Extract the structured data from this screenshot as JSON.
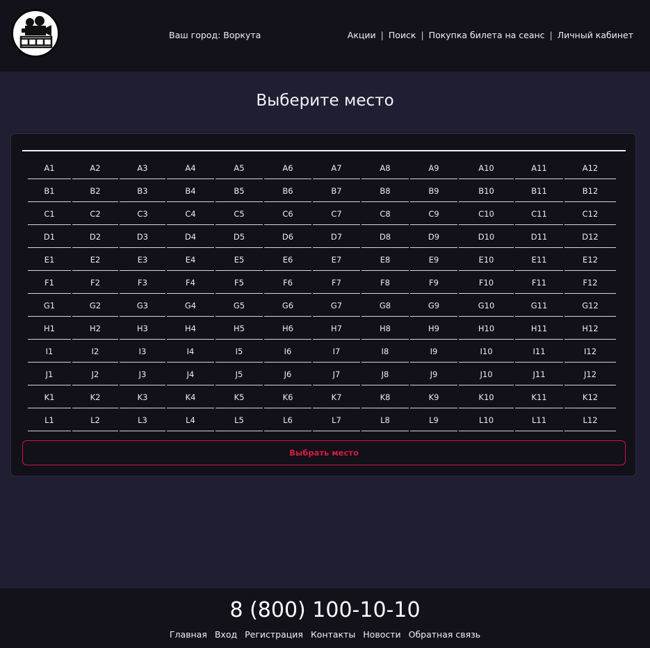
{
  "header": {
    "logo_icon": "film-camera-icon",
    "city_label": "Ваш город: Воркута",
    "nav": [
      {
        "label": "Акции"
      },
      {
        "label": "Поиск"
      },
      {
        "label": "Покупка билета на сеанс"
      },
      {
        "label": "Личный кабинет"
      }
    ],
    "nav_separator": "|"
  },
  "main": {
    "title": "Выберите место",
    "rows": [
      "A",
      "B",
      "C",
      "D",
      "E",
      "F",
      "G",
      "H",
      "I",
      "J",
      "K",
      "L"
    ],
    "seats_per_row": 12,
    "choose_button": "Выбрать место"
  },
  "footer": {
    "phone": "8 (800) 100-10-10",
    "links": [
      {
        "label": "Главная"
      },
      {
        "label": "Вход"
      },
      {
        "label": "Регистрация"
      },
      {
        "label": "Контакты"
      },
      {
        "label": "Новости"
      },
      {
        "label": "Обратная связь"
      }
    ]
  },
  "colors": {
    "background": "#201e33",
    "header_footer": "#13111a",
    "panel": "#121018",
    "accent": "#d21c44"
  }
}
